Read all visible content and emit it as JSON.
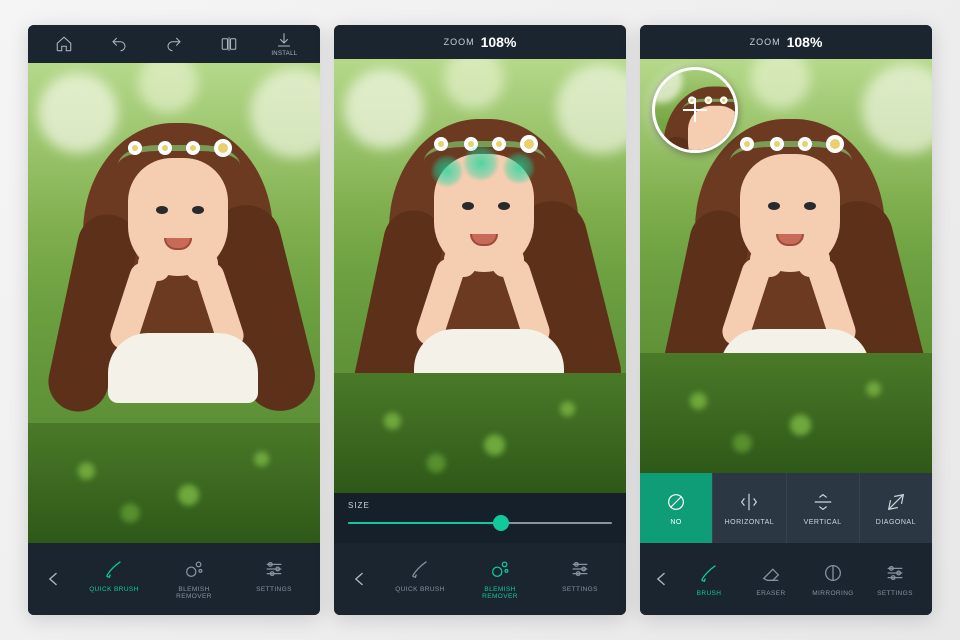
{
  "accent": "#12c99b",
  "topbar1": {
    "install_label": "INSTALL"
  },
  "zoom": {
    "label": "ZOOM",
    "value": "108%"
  },
  "size_strip": {
    "label": "SIZE",
    "value_pct": 58
  },
  "mirror_tabs": {
    "items": [
      {
        "label": "NO"
      },
      {
        "label": "HORIZONTAL"
      },
      {
        "label": "VERTICAL"
      },
      {
        "label": "DIAGONAL"
      }
    ],
    "active_index": 0
  },
  "bottombar1": {
    "tools": [
      {
        "label": "QUICK BRUSH"
      },
      {
        "label": "BLEMISH REMOVER"
      },
      {
        "label": "SETTINGS"
      }
    ],
    "active_index": 0
  },
  "bottombar2": {
    "tools": [
      {
        "label": "QUICK BRUSH"
      },
      {
        "label": "BLEMISH REMOVER"
      },
      {
        "label": "SETTINGS"
      }
    ],
    "active_index": 1
  },
  "bottombar3": {
    "tools": [
      {
        "label": "BRUSH"
      },
      {
        "label": "ERASER"
      },
      {
        "label": "MIRRORING"
      },
      {
        "label": "SETTINGS"
      }
    ],
    "active_index": 0
  }
}
